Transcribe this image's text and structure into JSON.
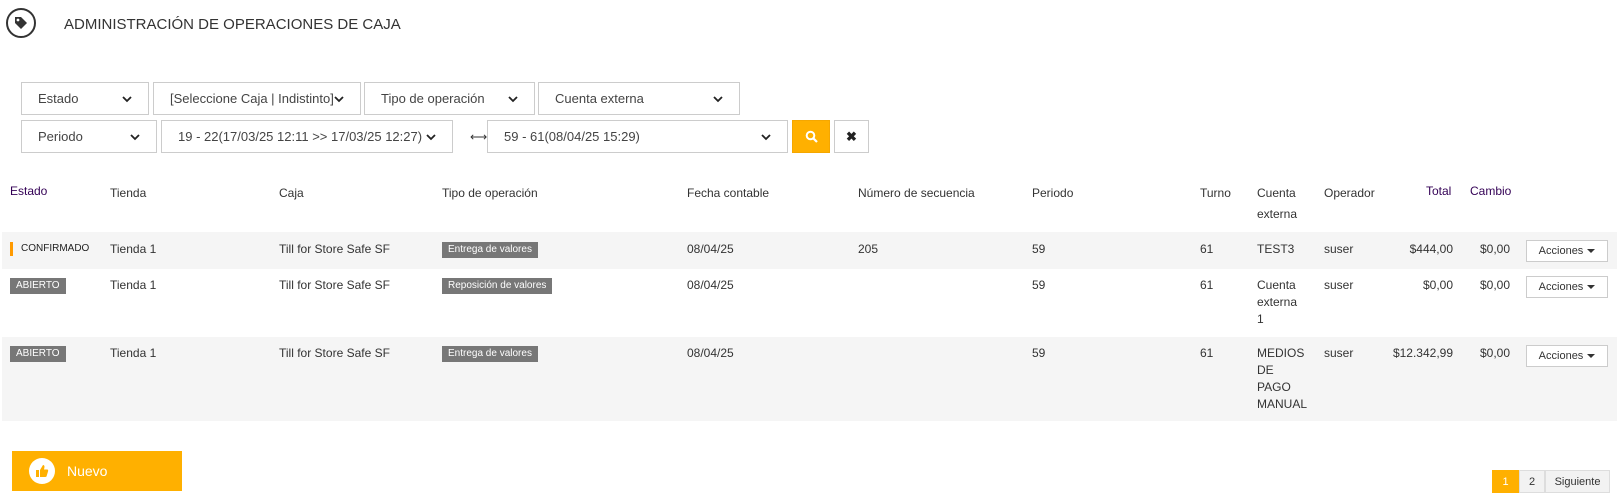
{
  "header": {
    "icon": "tag-icon",
    "title": "ADMINISTRACIÓN DE OPERACIONES DE CAJA"
  },
  "filters": {
    "estado": "Estado",
    "caja": "[Seleccione Caja | Indistinto]",
    "tipo_operacion": "Tipo de operación",
    "cuenta_externa": "Cuenta externa",
    "periodo": "Periodo",
    "periodo_desde": "19 - 22(17/03/25 12:11 >> 17/03/25 12:27)",
    "periodo_hasta": "59 - 61(08/04/25 15:29)",
    "range_separator": "⟷"
  },
  "columns": {
    "estado": "Estado",
    "tienda": "Tienda",
    "caja": "Caja",
    "tipo_operacion": "Tipo de operación",
    "fecha_contable": "Fecha contable",
    "numero_secuencia": "Número de secuencia",
    "periodo": "Periodo",
    "turno": "Turno",
    "cuenta_externa_1": "Cuenta",
    "cuenta_externa_2": "externa",
    "operador": "Operador",
    "total": "Total",
    "cambio": "Cambio"
  },
  "rows": [
    {
      "estado": "CONFIRMADO",
      "tienda": "Tienda 1",
      "caja": "Till for Store Safe SF",
      "tipo_operacion": "Entrega de valores",
      "fecha_contable": "08/04/25",
      "numero_secuencia": "205",
      "periodo": "59",
      "turno": "61",
      "cuenta_externa": [
        "TEST3"
      ],
      "operador": "suser",
      "total": "$444,00",
      "cambio": "$0,00",
      "acciones": "Acciones"
    },
    {
      "estado": "ABIERTO",
      "tienda": "Tienda 1",
      "caja": "Till for Store Safe SF",
      "tipo_operacion": "Reposición de valores",
      "fecha_contable": "08/04/25",
      "numero_secuencia": "",
      "periodo": "59",
      "turno": "61",
      "cuenta_externa": [
        "Cuenta",
        "externa",
        "1"
      ],
      "operador": "suser",
      "total": "$0,00",
      "cambio": "$0,00",
      "acciones": "Acciones"
    },
    {
      "estado": "ABIERTO",
      "tienda": "Tienda 1",
      "caja": "Till for Store Safe SF",
      "tipo_operacion": "Entrega de valores",
      "fecha_contable": "08/04/25",
      "numero_secuencia": "",
      "periodo": "59",
      "turno": "61",
      "cuenta_externa": [
        "MEDIOS",
        "DE",
        "PAGO",
        "MANUAL"
      ],
      "operador": "suser",
      "total": "$12.342,99",
      "cambio": "$0,00",
      "acciones": "Acciones"
    }
  ],
  "buttons": {
    "nuevo": "Nuevo",
    "nuevo_icon": "thumbs-up-icon",
    "search_icon": "search-icon",
    "clear_icon": "close-icon",
    "clear_glyph": "✖"
  },
  "pagination": {
    "pages": [
      "1",
      "2"
    ],
    "active": "1",
    "next": "Siguiente"
  },
  "colors": {
    "accent": "#ffb000",
    "badge_gray": "#777777",
    "confirm_bar": "#ff9a00"
  }
}
